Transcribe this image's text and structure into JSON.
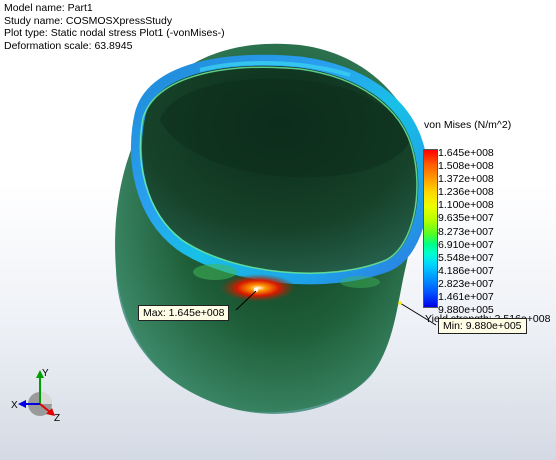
{
  "info": {
    "model_name": "Model name: Part1",
    "study_name": "Study name: COSMOSXpressStudy",
    "plot_type": "Plot type: Static nodal stress Plot1 (-vonMises-)",
    "deformation_scale": "Deformation scale: 63.8945"
  },
  "legend": {
    "title": "von Mises (N/m^2)",
    "values": [
      "1.645e+008",
      "1.508e+008",
      "1.372e+008",
      "1.236e+008",
      "1.100e+008",
      "9.635e+007",
      "8.273e+007",
      "6.910e+007",
      "5.548e+007",
      "4.186e+007",
      "2.823e+007",
      "1.461e+007",
      "9.880e+005"
    ],
    "yield_strength": "Yield strength: 3.516e+008"
  },
  "annotations": {
    "max": "Max: 1.645e+008",
    "min": "Min: 9.880e+005"
  },
  "axes": {
    "x": "X",
    "y": "Y",
    "z": "Z"
  },
  "colors": {
    "scale_max": "#ff0000",
    "scale_min": "#0000e6",
    "model_body": "#1e4a30",
    "callout_bg": "#fffde6"
  }
}
